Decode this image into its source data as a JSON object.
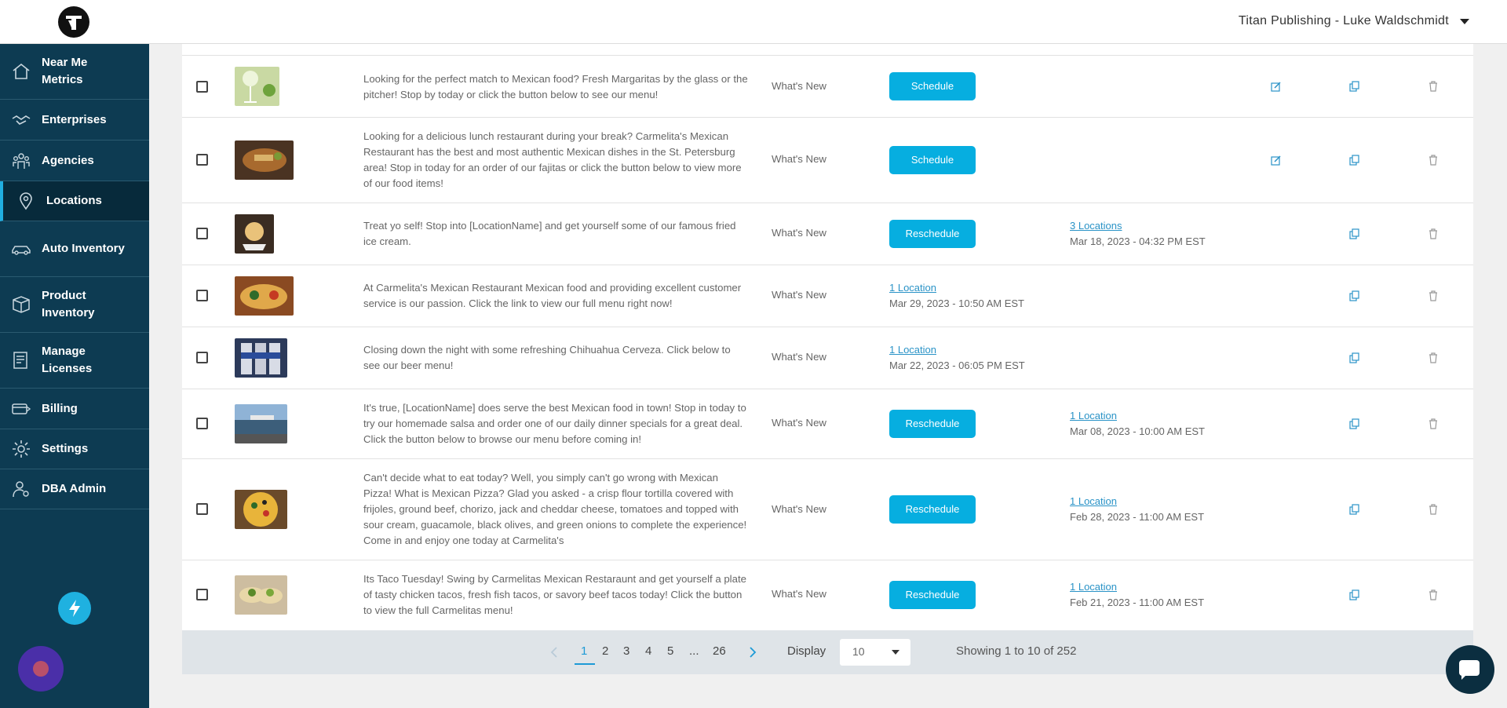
{
  "header": {
    "account_name": "Titan Publishing - Luke Waldschmidt",
    "logo_icon": "titan-logo-icon"
  },
  "sidebar": {
    "items": [
      {
        "label": "Near Me Metrics",
        "icon": "home-icon"
      },
      {
        "label": "Enterprises",
        "icon": "handshake-icon"
      },
      {
        "label": "Agencies",
        "icon": "people-icon"
      },
      {
        "label": "Locations",
        "icon": "map-pin-icon",
        "active": true
      },
      {
        "label": "Auto Inventory",
        "icon": "car-icon"
      },
      {
        "label": "Product Inventory",
        "icon": "box-icon"
      },
      {
        "label": "Manage Licenses",
        "icon": "license-icon"
      },
      {
        "label": "Billing",
        "icon": "billing-icon"
      },
      {
        "label": "Settings",
        "icon": "gear-icon"
      },
      {
        "label": "DBA Admin",
        "icon": "admin-user-icon"
      }
    ]
  },
  "posts": [
    {
      "description": "Looking for the perfect match to Mexican food? Fresh Margaritas by the glass or the pitcher! Stop by today or click the button below to see our menu!",
      "category": "What's New",
      "button": "Schedule",
      "schedule_link": "",
      "schedule_date": "",
      "editable": true,
      "thumb": "margarita"
    },
    {
      "description": "Looking for a delicious lunch restaurant during your break? Carmelita's Mexican Restaurant has the best and most authentic Mexican dishes in the St. Petersburg area! Stop in today for an order of our fajitas or click the button below to view more of our food items!",
      "category": "What's New",
      "button": "Schedule",
      "schedule_link": "",
      "schedule_date": "",
      "editable": true,
      "thumb": "fajitas"
    },
    {
      "description": "Treat yo self! Stop into [LocationName] and get yourself some of our famous fried ice cream.",
      "category": "What's New",
      "button": "Reschedule",
      "schedule_link": "3 Locations",
      "schedule_date": "Mar 18, 2023 - 04:32 PM EST",
      "editable": false,
      "thumb": "ice-cream"
    },
    {
      "description": "At Carmelita's Mexican Restaurant Mexican food and providing excellent customer service is our passion. Click the link to view our full menu right now!",
      "category": "What's New",
      "button": "",
      "schedule_link": "1 Location",
      "schedule_date": "Mar 29, 2023 - 10:50 AM EST",
      "editable": false,
      "thumb": "platter"
    },
    {
      "description": "Closing down the night with some refreshing Chihuahua Cerveza. Click below to see our beer menu!",
      "category": "What's New",
      "button": "",
      "schedule_link": "1 Location",
      "schedule_date": "Mar 22, 2023 - 06:05 PM EST",
      "editable": false,
      "thumb": "beer"
    },
    {
      "description": "It's true, [LocationName] does serve the best Mexican food in town! Stop in today to try our homemade salsa and order one of our daily dinner specials for a great deal. Click the button below to browse our menu before coming in!",
      "category": "What's New",
      "button": "Reschedule",
      "schedule_link": "1 Location",
      "schedule_date": "Mar 08, 2023 - 10:00 AM EST",
      "editable": false,
      "thumb": "storefront"
    },
    {
      "description": "Can't decide what to eat today? Well, you simply can't go wrong with Mexican Pizza! What is Mexican Pizza? Glad you asked - a crisp flour tortilla covered with frijoles, ground beef, chorizo, jack and cheddar cheese, tomatoes and topped with sour cream, guacamole, black olives, and green onions to complete the experience! Come in and enjoy one today at Carmelita's",
      "category": "What's New",
      "button": "Reschedule",
      "schedule_link": "1 Location",
      "schedule_date": "Feb 28, 2023 - 11:00 AM EST",
      "editable": false,
      "thumb": "pizza"
    },
    {
      "description": "Its Taco Tuesday! Swing by Carmelitas Mexican Restaraunt and get yourself a plate of tasty chicken tacos, fresh fish tacos, or savory beef tacos today! Click the button to view the full Carmelitas menu!",
      "category": "What's New",
      "button": "Reschedule",
      "schedule_link": "1 Location",
      "schedule_date": "Feb 21, 2023 - 11:00 AM EST",
      "editable": false,
      "thumb": "tacos"
    }
  ],
  "pagination": {
    "pages": [
      "1",
      "2",
      "3",
      "4",
      "5",
      "...",
      "26"
    ],
    "current": "1",
    "display_label": "Display",
    "display_value": "10",
    "showing": "Showing 1 to 10 of 252"
  },
  "colors": {
    "sidebar": "#0d3b52",
    "accent": "#06aee0",
    "link": "#2a93c7"
  }
}
